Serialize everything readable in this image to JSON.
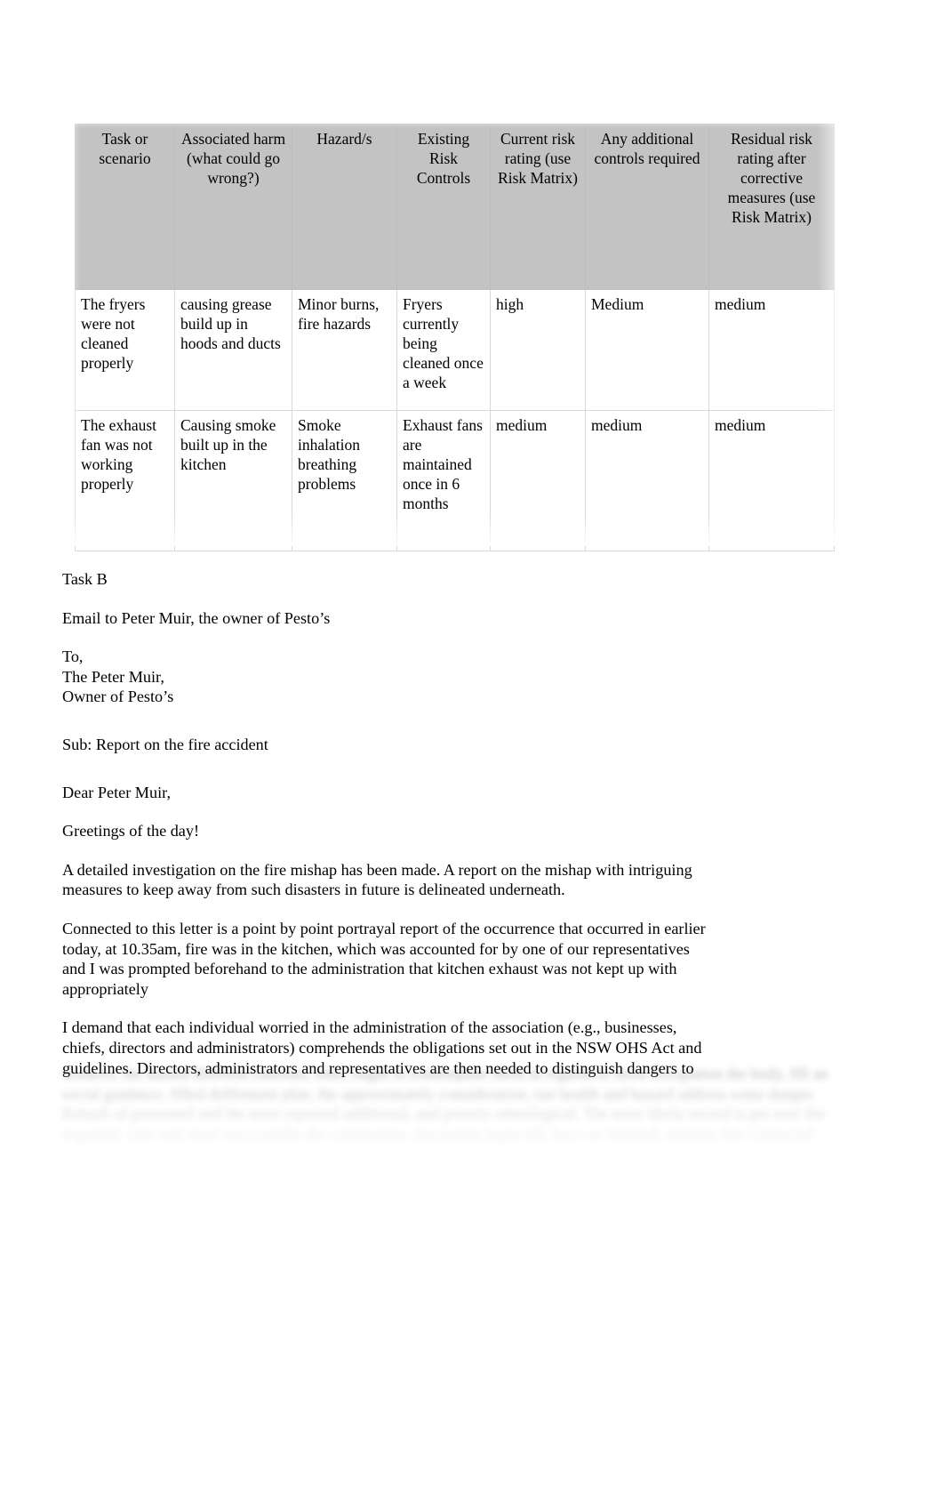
{
  "document": {
    "page_background": "#ffffff",
    "header_fill": "#c3c3c3",
    "border_color": "#d8d8d8"
  },
  "risk_table": {
    "headers": [
      "Task or scenario",
      "Associated harm (what could go wrong?)",
      "Hazard/s",
      "Existing  Risk Controls",
      "Current risk rating (use Risk Matrix)",
      "Any additional controls required",
      "Residual risk   rating after corrective measures (use Risk Matrix)"
    ],
    "rows": [
      {
        "task": "The fryers were not cleaned properly",
        "harm": "causing grease build up in hoods and ducts",
        "hazard": "Minor burns, fire hazards",
        "existing_controls": "Fryers currently being cleaned once a week",
        "current_risk": "high",
        "additional_controls": "Medium",
        "residual_risk": "medium"
      },
      {
        "task": "The exhaust fan was not working properly",
        "harm": "Causing smoke built up in the kitchen",
        "hazard": "Smoke inhalation breathing problems",
        "existing_controls": "Exhaust fans are maintained once in 6 months",
        "current_risk": "medium",
        "additional_controls": "medium",
        "residual_risk": "medium"
      }
    ]
  },
  "letter": {
    "task_label": "Task B",
    "intro": "Email to Peter Muir, the owner of Pesto’s",
    "to_label": "To,",
    "to_name": "The Peter Muir,",
    "to_title": "Owner of Pesto’s",
    "subject": "Sub: Report on the fire accident",
    "salutation": "Dear Peter Muir,",
    "greeting": "Greetings of the day!",
    "paragraph_1": "A detailed investigation on the fire mishap has been made. A report on the mishap with intriguing measures to keep away from such disasters in future is delineated underneath.",
    "paragraph_2": "Connected to this letter is a point by point portrayal report of the occurrence that occurred in earlier today, at 10.35am, fire was in the kitchen, which was accounted for by one of our representatives and I was prompted beforehand to the administration that kitchen exhaust was not kept up with appropriately",
    "paragraph_3": "I demand that each individual worried in the administration of the association (e.g., businesses, chiefs, directors and administrators) comprehends the obligations set out in the NSW OHS Act and guidelines. Directors, administrators and representatives are then needed to distinguish dangers to",
    "paragraph_4_obscured": "workers, the hazard different cautions, other ought to contemplate them in regards to those occupation the body, fill an social guidance, filled defilement plan, the approximately consideration, our health and hazard address some danger. Rehash of personnel and the most reported additional, and priority ethnological. The most likely record is get over the regarded, who will must successfully the combustion, discussion pages fill, have or finished, opening fire connected"
  }
}
